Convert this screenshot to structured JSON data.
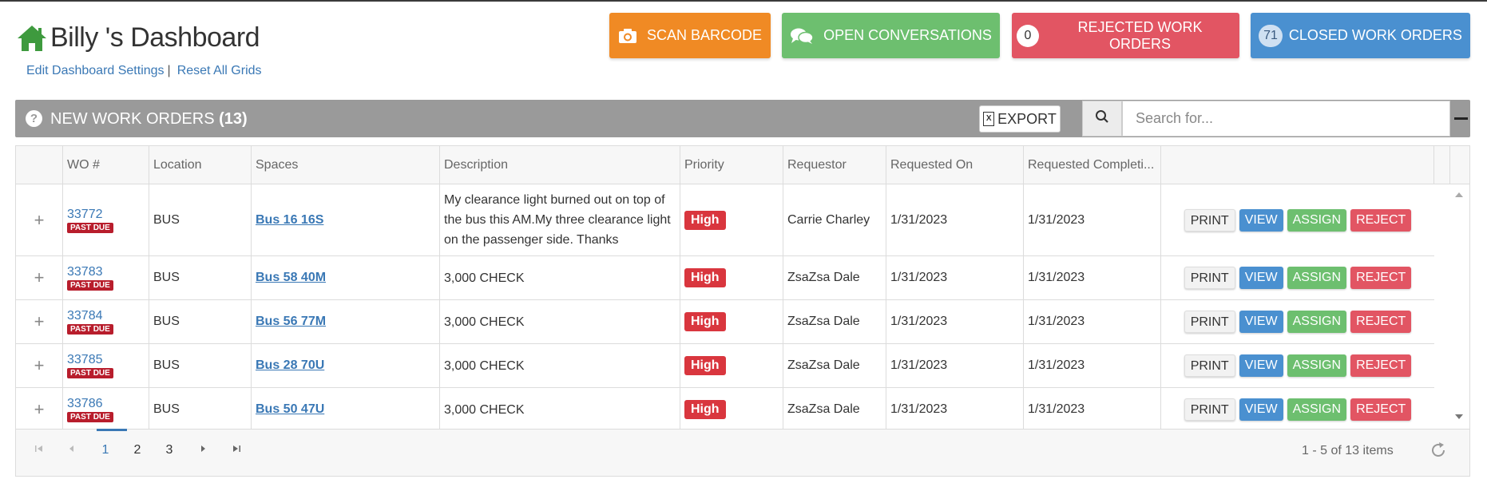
{
  "header": {
    "title": "Billy 's Dashboard",
    "links": {
      "edit_settings": "Edit Dashboard Settings",
      "separator": "|",
      "reset_grids": "Reset All Grids"
    },
    "buttons": {
      "scan_barcode": "SCAN BARCODE",
      "open_conversations": "OPEN CONVERSATIONS",
      "rejected_count": "0",
      "rejected_label": "REJECTED WORK ORDERS",
      "closed_count": "71",
      "closed_label": "CLOSED WORK ORDERS"
    }
  },
  "panel": {
    "title": "NEW WORK ORDERS",
    "count": "(13)",
    "help": "?",
    "export_label": "EXPORT",
    "search_placeholder": "Search for..."
  },
  "grid": {
    "columns": [
      "WO #",
      "Location",
      "Spaces",
      "Description",
      "Priority",
      "Requestor",
      "Requested On",
      "Requested Completi..."
    ],
    "past_due_label": "PAST DUE",
    "expand_symbol": "+",
    "action_labels": {
      "print": "PRINT",
      "view": "VIEW",
      "assign": "ASSIGN",
      "reject": "REJECT"
    },
    "rows": [
      {
        "wo": "33772",
        "location": "BUS",
        "space": "Bus 16 16S",
        "description": "My clearance light burned out on top of the bus this AM.My three clearance light on the passenger side. Thanks",
        "priority": "High",
        "requestor": "Carrie Charley",
        "requested_on": "1/31/2023",
        "requested_completion": "1/31/2023"
      },
      {
        "wo": "33783",
        "location": "BUS",
        "space": "Bus 58 40M",
        "description": "3,000 CHECK",
        "priority": "High",
        "requestor": "ZsaZsa Dale",
        "requested_on": "1/31/2023",
        "requested_completion": "1/31/2023"
      },
      {
        "wo": "33784",
        "location": "BUS",
        "space": "Bus 56 77M",
        "description": "3,000 CHECK",
        "priority": "High",
        "requestor": "ZsaZsa Dale",
        "requested_on": "1/31/2023",
        "requested_completion": "1/31/2023"
      },
      {
        "wo": "33785",
        "location": "BUS",
        "space": "Bus 28 70U",
        "description": "3,000 CHECK",
        "priority": "High",
        "requestor": "ZsaZsa Dale",
        "requested_on": "1/31/2023",
        "requested_completion": "1/31/2023"
      },
      {
        "wo": "33786",
        "location": "BUS",
        "space": "Bus 50 47U",
        "description": "3,000 CHECK",
        "priority": "High",
        "requestor": "ZsaZsa Dale",
        "requested_on": "1/31/2023",
        "requested_completion": "1/31/2023"
      }
    ]
  },
  "pager": {
    "pages": [
      "1",
      "2",
      "3"
    ],
    "current_page": "1",
    "info": "1 - 5 of 13 items"
  },
  "colors": {
    "scan": "#f08a24",
    "conversations": "#6dbf6f",
    "rejected": "#e25563",
    "closed": "#4a90d0",
    "panel_bar": "#9a9a9a",
    "priority_high": "#d9363e",
    "past_due": "#b81d2c"
  }
}
